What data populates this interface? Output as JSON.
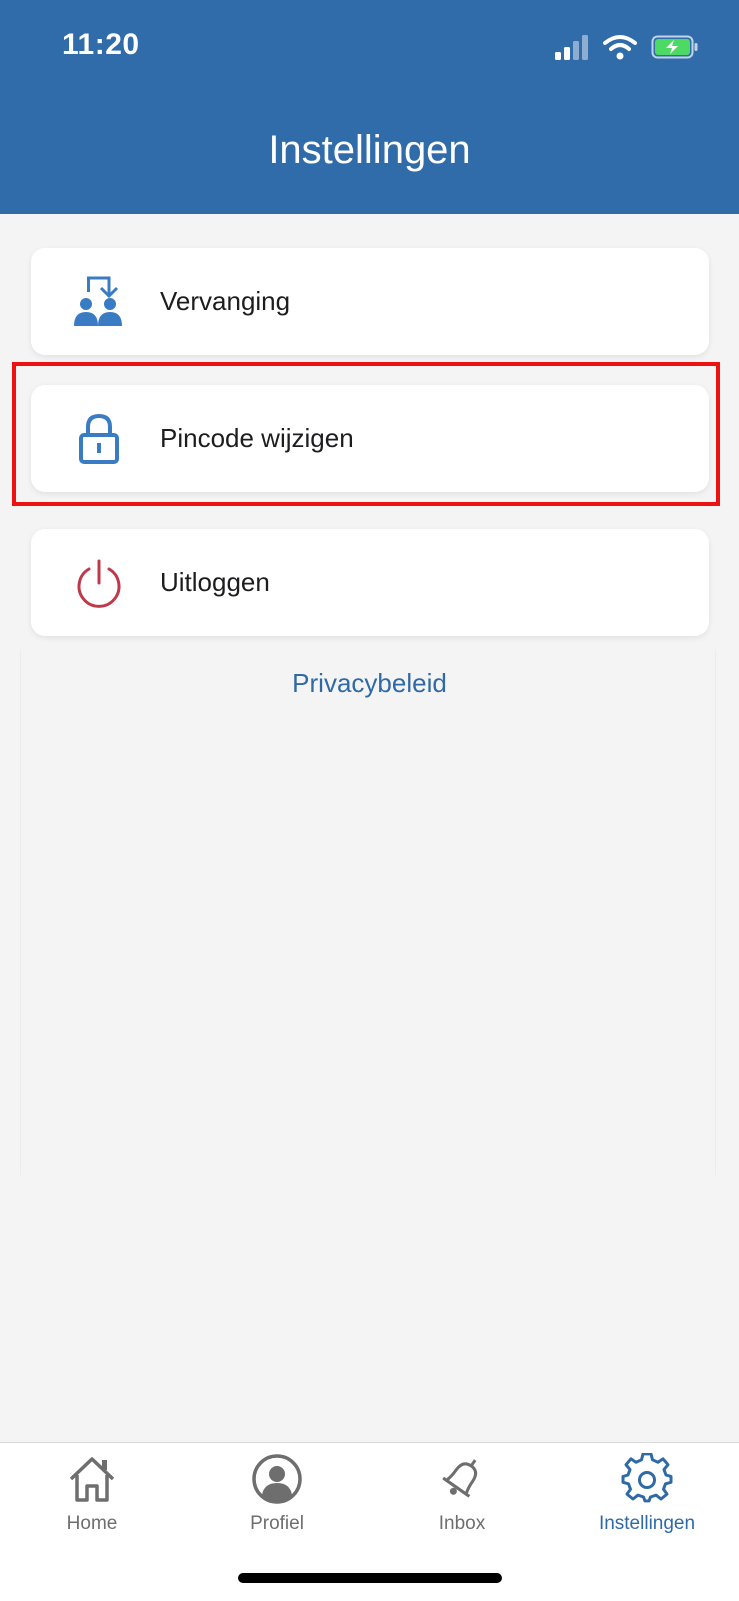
{
  "status_bar": {
    "time": "11:20"
  },
  "header": {
    "title": "Instellingen"
  },
  "menu": [
    {
      "label": "Vervanging",
      "icon": "replacement-users-icon"
    },
    {
      "label": "Pincode wijzigen",
      "icon": "lock-icon"
    },
    {
      "label": "Uitloggen",
      "icon": "power-icon"
    }
  ],
  "privacy": {
    "label": "Privacybeleid"
  },
  "tabs": [
    {
      "label": "Home",
      "icon": "home-icon"
    },
    {
      "label": "Profiel",
      "icon": "profile-icon"
    },
    {
      "label": "Inbox",
      "icon": "bell-icon"
    },
    {
      "label": "Instellingen",
      "icon": "gear-icon",
      "active": true
    }
  ],
  "colors": {
    "header": "#316caa",
    "accent": "#2f6aa6",
    "icon_blue": "#3a7cc4",
    "logout_red": "#c0394b",
    "highlight": "#ee1111"
  }
}
